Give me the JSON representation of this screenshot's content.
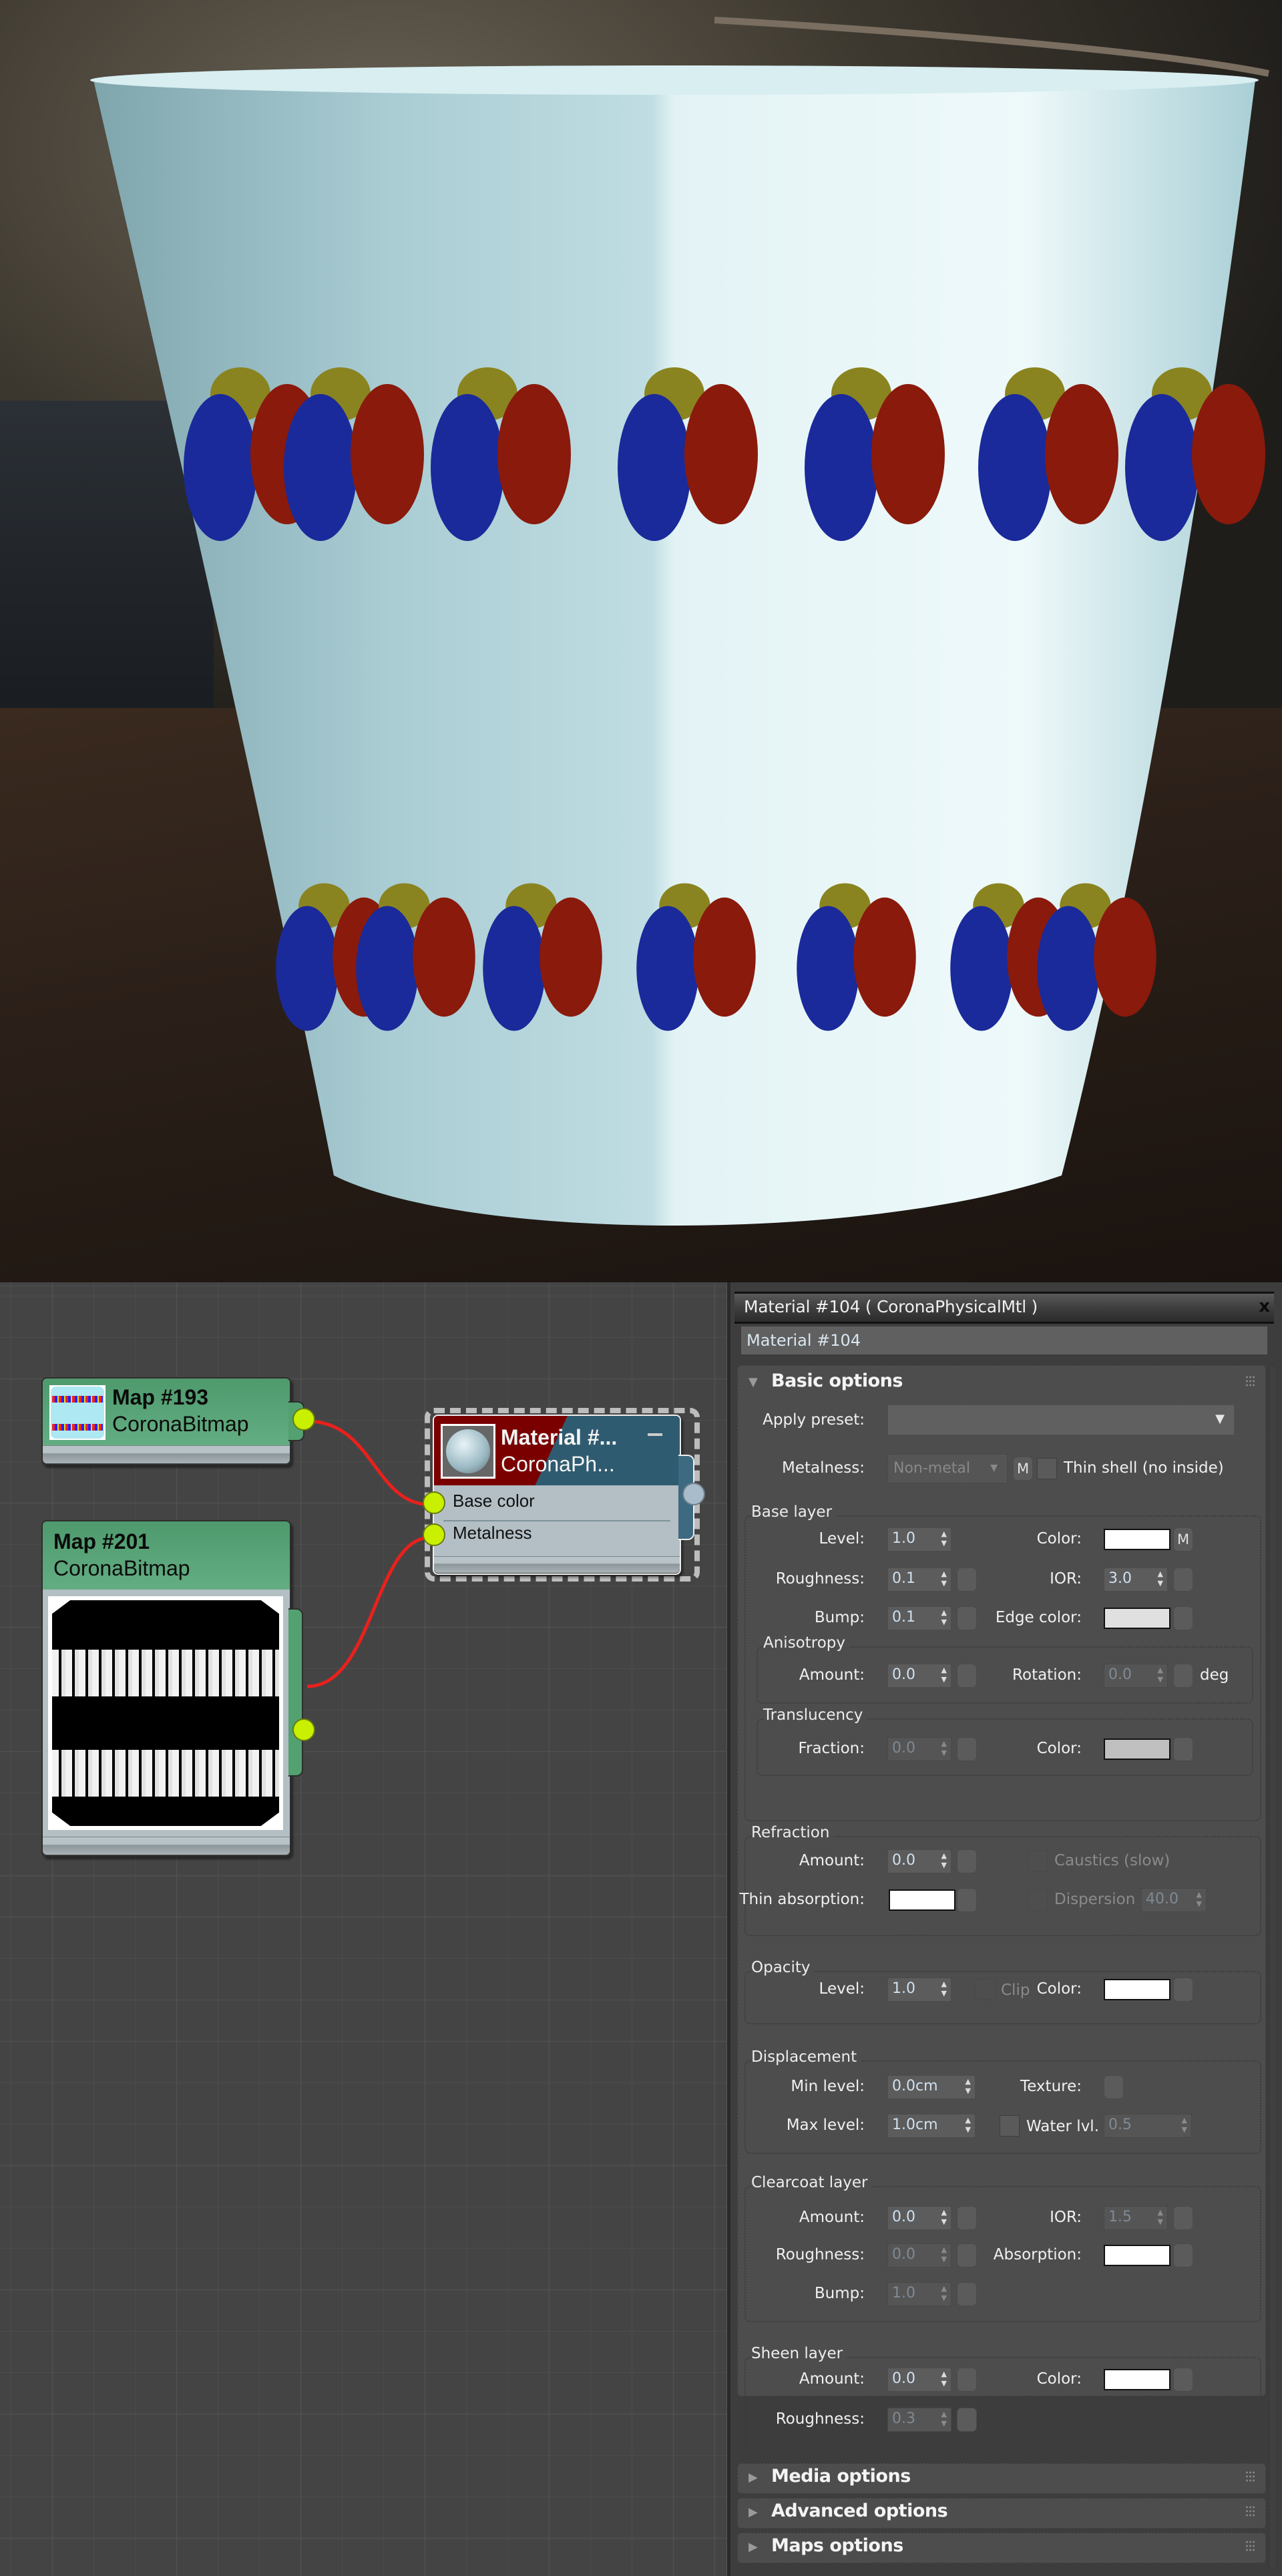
{
  "render": {
    "description": "Rendered enamel bucket with balloon decals",
    "colors": {
      "bucket": "#cfe6ea",
      "balloon_blue": "#1a2a9a",
      "balloon_red": "#8a1a0c",
      "balloon_yellow": "#8a8420",
      "table": "#2b2019"
    }
  },
  "node_editor": {
    "nodes": [
      {
        "id": "map193",
        "title": "Map #193",
        "subtitle": "CoronaBitmap",
        "color": "#55a374",
        "output_socket": "yes"
      },
      {
        "id": "map201",
        "title": "Map #201",
        "subtitle": "CoronaBitmap",
        "color": "#55a374",
        "output_socket": "yes"
      },
      {
        "id": "material",
        "title": "Material #...",
        "subtitle": "CoronaPh...",
        "inputs": [
          "Base color",
          "Metalness"
        ],
        "selected": true
      }
    ],
    "connections": [
      {
        "from": "Map #193",
        "to": "Base color"
      },
      {
        "from": "Map #201",
        "to": "Metalness"
      }
    ],
    "socket_color": "#c8f000",
    "wire_color": "#e8211c"
  },
  "panel": {
    "title": "Material #104  ( CoronaPhysicalMtl )",
    "close_label": "x",
    "name_value": "Material #104",
    "basic_options": {
      "title": "Basic options",
      "apply_preset_label": "Apply preset:",
      "apply_preset_value": "",
      "metalness_label": "Metalness:",
      "metalness_value": "Non-metal",
      "m_label": "M",
      "thin_shell_label": "Thin shell (no inside)",
      "base_layer": {
        "title": "Base layer",
        "level_label": "Level:",
        "level": "1.0",
        "color_label": "Color:",
        "color": "#ffffff",
        "roughness_label": "Roughness:",
        "roughness": "0.1",
        "ior_label": "IOR:",
        "ior": "3.0",
        "bump_label": "Bump:",
        "bump": "0.1",
        "edge_color_label": "Edge color:",
        "edge_color": "#e0e0e0"
      },
      "anisotropy": {
        "title": "Anisotropy",
        "amount_label": "Amount:",
        "amount": "0.0",
        "rotation_label": "Rotation:",
        "rotation": "0.0",
        "unit": "deg"
      },
      "translucency": {
        "title": "Translucency",
        "fraction_label": "Fraction:",
        "fraction": "0.0",
        "color_label": "Color:",
        "color": "#c0c0c0"
      },
      "refraction": {
        "title": "Refraction",
        "amount_label": "Amount:",
        "amount": "0.0",
        "caustics_label": "Caustics (slow)",
        "thin_absorption_label": "Thin absorption:",
        "thin_absorption": "#ffffff",
        "dispersion_label": "Dispersion",
        "dispersion": "40.0"
      },
      "opacity": {
        "title": "Opacity",
        "level_label": "Level:",
        "level": "1.0",
        "clip_label": "Clip",
        "color_label": "Color:",
        "color": "#ffffff"
      },
      "displacement": {
        "title": "Displacement",
        "min_label": "Min level:",
        "min": "0.0cm",
        "texture_label": "Texture:",
        "max_label": "Max level:",
        "max": "1.0cm",
        "water_label": "Water lvl.",
        "water": "0.5"
      },
      "clearcoat": {
        "title": "Clearcoat layer",
        "amount_label": "Amount:",
        "amount": "0.0",
        "ior_label": "IOR:",
        "ior": "1.5",
        "roughness_label": "Roughness:",
        "roughness": "0.0",
        "absorption_label": "Absorption:",
        "absorption": "#ffffff",
        "bump_label": "Bump:",
        "bump": "1.0"
      },
      "sheen": {
        "title": "Sheen layer",
        "amount_label": "Amount:",
        "amount": "0.0",
        "color_label": "Color:",
        "color": "#ffffff",
        "roughness_label": "Roughness:",
        "roughness": "0.3"
      }
    },
    "collapsed_rollouts": [
      "Media options",
      "Advanced options",
      "Maps options"
    ]
  }
}
